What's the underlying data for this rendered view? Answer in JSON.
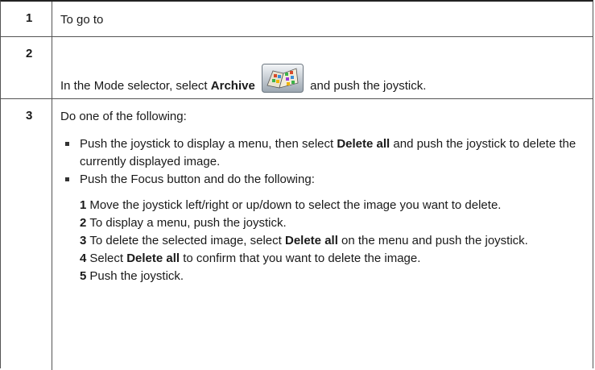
{
  "rows": [
    {
      "number": "1",
      "text": "To go to"
    },
    {
      "number": "2",
      "text_before": "In the Mode selector, select ",
      "bold": "Archive",
      "icon": "archive-book-icon",
      "text_after": " and push the joystick."
    },
    {
      "number": "3",
      "intro": "Do one of the following:",
      "bullet1": {
        "before": "Push the joystick to display a menu, then select ",
        "bold": "Delete all",
        "after": " and push the joystick to delete the currently displayed image."
      },
      "bullet2": {
        "text": "Push the Focus button and do the following:"
      },
      "steps": [
        {
          "n": "1",
          "before": "Move the joystick left/right or up/down to select the image you want to delete.",
          "bold": "",
          "after": ""
        },
        {
          "n": "2",
          "before": "To display a menu, push the joystick.",
          "bold": "",
          "after": ""
        },
        {
          "n": "3",
          "before": "To delete the selected image, select ",
          "bold": "Delete all",
          "after": " on the menu and push the joystick."
        },
        {
          "n": "4",
          "before": "Select ",
          "bold": "Delete all",
          "after": " to confirm that you want to delete the image."
        },
        {
          "n": "5",
          "before": "Push the joystick.",
          "bold": "",
          "after": ""
        }
      ]
    }
  ]
}
